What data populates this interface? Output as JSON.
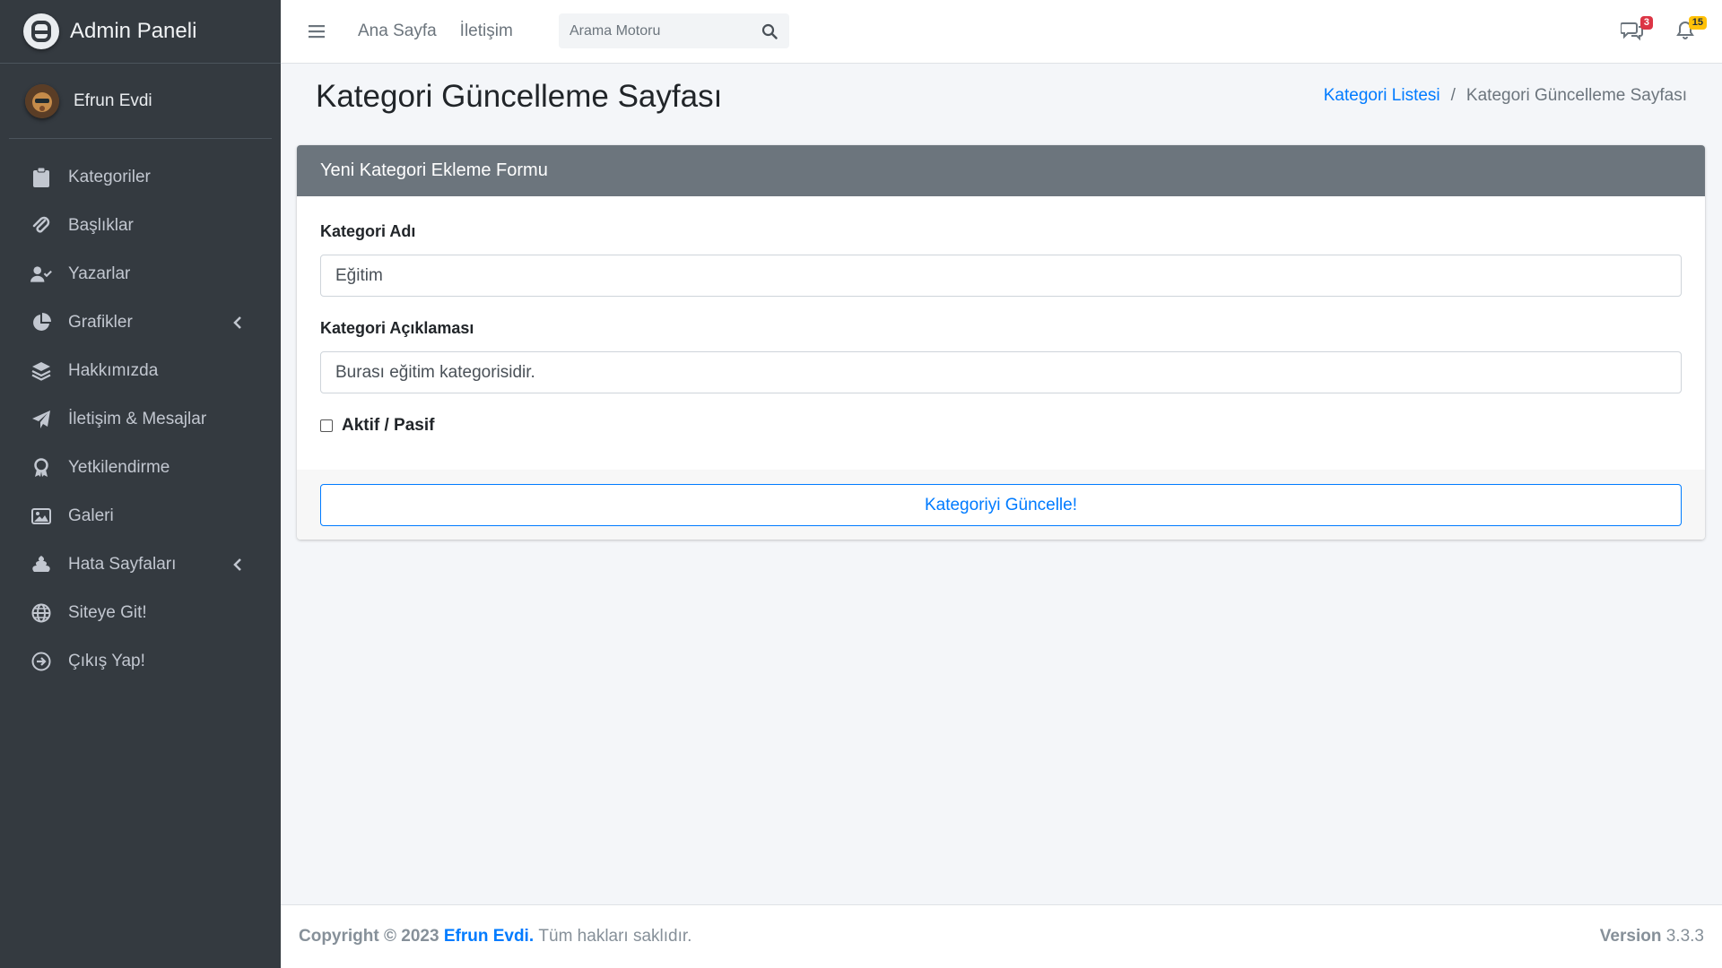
{
  "brand": {
    "title": "Admin Paneli"
  },
  "user": {
    "name": "Efrun Evdi"
  },
  "sidebar": {
    "items": [
      {
        "label": "Kategoriler",
        "icon": "clipboard-icon"
      },
      {
        "label": "Başlıklar",
        "icon": "paperclip-icon"
      },
      {
        "label": "Yazarlar",
        "icon": "user-check-icon"
      },
      {
        "label": "Grafikler",
        "icon": "chart-pie-icon",
        "has_children": true
      },
      {
        "label": "Hakkımızda",
        "icon": "layer-group-icon"
      },
      {
        "label": "İletişim & Mesajlar",
        "icon": "paper-plane-icon"
      },
      {
        "label": "Yetkilendirme",
        "icon": "award-icon"
      },
      {
        "label": "Galeri",
        "icon": "image-icon"
      },
      {
        "label": "Hata Sayfaları",
        "icon": "poo-icon",
        "has_children": true
      },
      {
        "label": "Siteye Git!",
        "icon": "globe-icon"
      },
      {
        "label": "Çıkış Yap!",
        "icon": "sign-out-icon"
      }
    ]
  },
  "topbar": {
    "links": [
      "Ana Sayfa",
      "İletişim"
    ],
    "search_placeholder": "Arama Motoru",
    "messages_count": "3",
    "notifications_count": "15"
  },
  "page": {
    "title": "Kategori Güncelleme Sayfası",
    "breadcrumb": {
      "parent": "Kategori Listesi",
      "current": "Kategori Güncelleme Sayfası"
    }
  },
  "form": {
    "header": "Yeni Kategori Ekleme Formu",
    "name_label": "Kategori Adı",
    "name_value": "Eğitim",
    "desc_label": "Kategori Açıklaması",
    "desc_value": "Burası eğitim kategorisidir.",
    "active_label": "Aktif / Pasif",
    "active_checked": false,
    "submit_label": "Kategoriyi Güncelle!"
  },
  "footer": {
    "copyright": "Copyright © 2023",
    "company": "Efrun Evdi.",
    "rights": "Tüm hakları saklıdır.",
    "version_label": "Version",
    "version": "3.3.3"
  },
  "colors": {
    "sidebar_bg": "#343a40",
    "primary": "#007bff",
    "card_header_bg": "#6c757d",
    "badge_danger": "#dc3545",
    "badge_warning": "#ffc107"
  }
}
